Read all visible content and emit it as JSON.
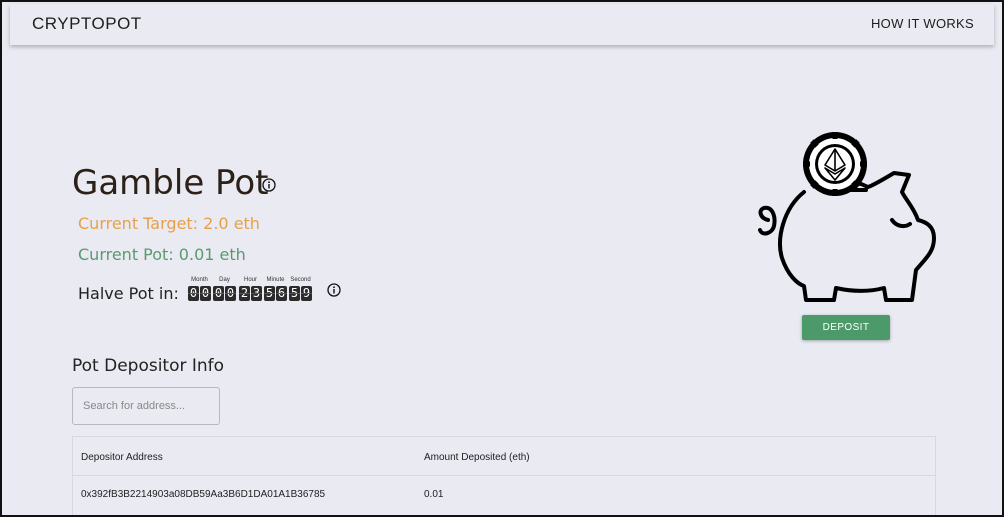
{
  "header": {
    "brand": "CRYPTOPOT",
    "nav_how_it_works": "HOW IT WORKS"
  },
  "pot": {
    "title": "Gamble Pot",
    "current_target": "Current Target: 2.0 eth",
    "current_pot": "Current Pot: 0.01 eth",
    "halve_label": "Halve Pot in:",
    "timer": [
      {
        "label": "Month",
        "digits": [
          "0",
          "0"
        ]
      },
      {
        "label": "Day",
        "digits": [
          "0",
          "0"
        ]
      },
      {
        "label": "Hour",
        "digits": [
          "2",
          "3"
        ]
      },
      {
        "label": "Minute",
        "digits": [
          "5",
          "6"
        ]
      },
      {
        "label": "Second",
        "digits": [
          "5",
          "9"
        ]
      }
    ],
    "deposit_label": "DEPOSIT"
  },
  "depositors": {
    "title": "Pot Depositor Info",
    "search_placeholder": "Search for address...",
    "columns": [
      "Depositor Address",
      "Amount Deposited (eth)"
    ],
    "rows": [
      [
        "0x392fB3B2214903a08DB59Aa3B6D1DA01A1B36785",
        "0.01"
      ]
    ]
  }
}
